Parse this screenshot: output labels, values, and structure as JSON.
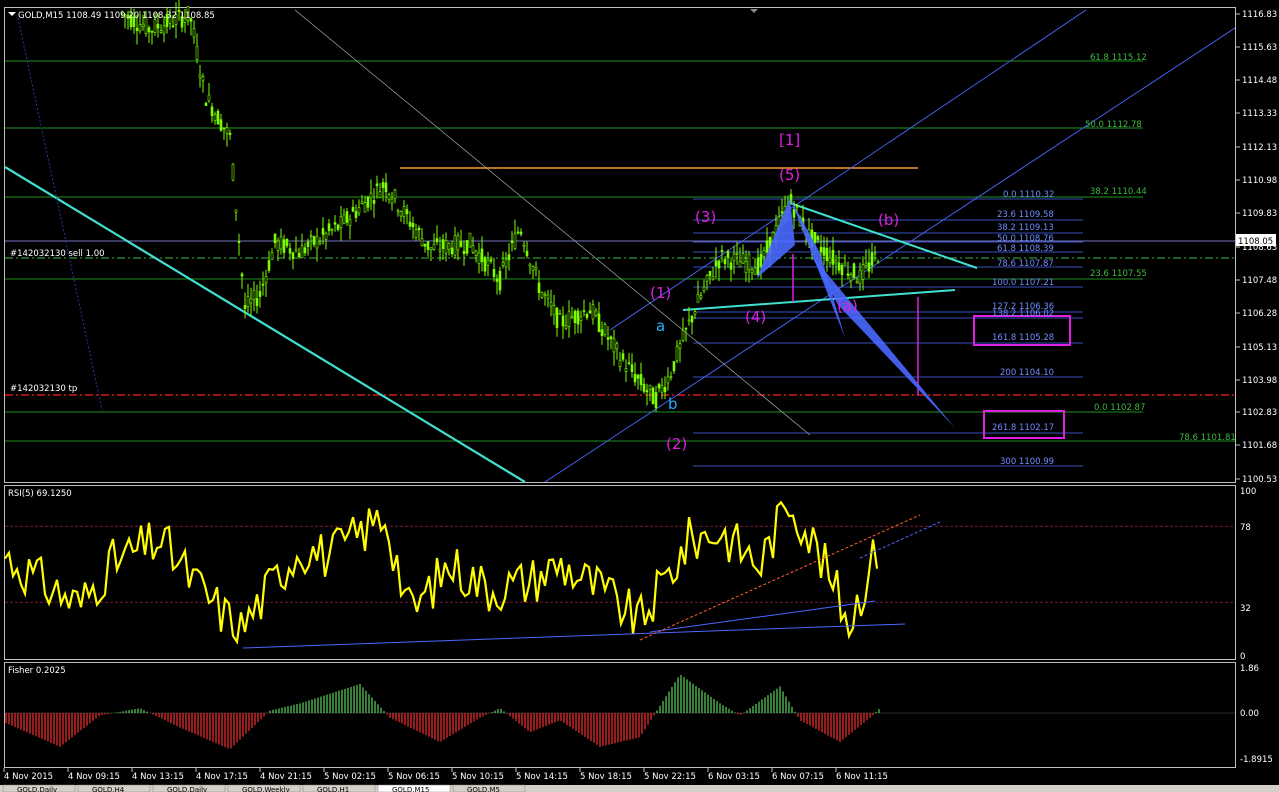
{
  "symbol_header": "GOLD,M15  1108.49 1109.20 1108.32 1108.85",
  "current_price": "1108.05",
  "order_sell_label": "#142032130 sell 1.00",
  "order_tp_label": "#142032130 tp",
  "rsi_label": "RSI(5) 69.1250",
  "fisher_label": "Fisher 0.2025",
  "price_axis_ticks": [
    "1116.83",
    "1115.63",
    "1114.48",
    "1113.33",
    "1112.13",
    "1110.98",
    "1109.83",
    "1108.63",
    "1107.48",
    "1106.28",
    "1105.13",
    "1103.98",
    "1102.83",
    "1101.68",
    "1100.53"
  ],
  "rsi_axis_ticks": [
    "100",
    "78",
    "32",
    "0"
  ],
  "fisher_axis_ticks": [
    "1.86",
    "0.00",
    "-1.8915"
  ],
  "time_axis_ticks": [
    "4 Nov 2015",
    "4 Nov 09:15",
    "4 Nov 13:15",
    "4 Nov 17:15",
    "4 Nov 21:15",
    "5 Nov 02:15",
    "5 Nov 06:15",
    "5 Nov 10:15",
    "5 Nov 14:15",
    "5 Nov 18:15",
    "5 Nov 22:15",
    "6 Nov 03:15",
    "6 Nov 07:15",
    "6 Nov 11:15"
  ],
  "wave_labels": {
    "w1": "(1)",
    "w2": "(2)",
    "w3": "(3)",
    "w4": "(4)",
    "w5": "(5)",
    "big1": "[1]",
    "wa": "(a)",
    "wb": "(b)",
    "sa": "a",
    "sb": "b"
  },
  "fib_right_green": [
    "61.8 1115.12",
    "50.0 1112.78",
    "38.2 1110.44",
    "23.6 1107.55",
    "0.0 1102.87",
    "78.6 1101.81"
  ],
  "fib_right_blue": [
    "0.0 1110.32",
    "23.6 1109.58",
    "38.2 1109.13",
    "50.0 1108.76",
    "61.8 1108.39",
    "78.6 1107.87",
    "100.0 1107.21",
    "127.2 1106.36",
    "138.2 1106.02",
    "161.8 1105.28",
    "200 1104.10",
    "261.8 1102.17",
    "300 1100.99"
  ],
  "bottom_tabs": [
    "GOLD,Daily",
    "GOLD,H4",
    "GOLD,Daily",
    "GOLD,Weekly",
    "GOLD,H1",
    "GOLD,M15",
    "GOLD,M5"
  ],
  "colors": {
    "candle": "#7cfc00",
    "rsi": "#ffff00",
    "fib_blue": "#4a68ff",
    "fib_green": "#1f8f1f",
    "magenta": "#e020e0",
    "orange": "#ff9933",
    "cyan": "#40e0d0",
    "tp_red": "#ff2020",
    "fisher_pos": "#5cd65c",
    "fisher_neg": "#ff3030"
  },
  "chart_data": {
    "type": "line",
    "title": "GOLD,M15",
    "ylabel": "",
    "xlabel": "",
    "ylim": [
      1100.53,
      1116.83
    ],
    "x": [
      "4 Nov 2015",
      "4 Nov 09:15",
      "4 Nov 13:15",
      "4 Nov 17:15",
      "4 Nov 21:15",
      "5 Nov 02:15",
      "5 Nov 06:15",
      "5 Nov 10:15",
      "5 Nov 14:15",
      "5 Nov 18:15",
      "5 Nov 22:15",
      "6 Nov 03:15",
      "6 Nov 07:15",
      "6 Nov 11:15"
    ],
    "series": [
      {
        "values": [
          1116.9,
          1116.5,
          1116.8,
          1106.6,
          1108.6,
          1110.8,
          1108.6,
          1107.6,
          1106.0,
          1105.5,
          1103.3,
          1107.5,
          1110.3,
          1108.3
        ]
      }
    ],
    "grid": false
  }
}
